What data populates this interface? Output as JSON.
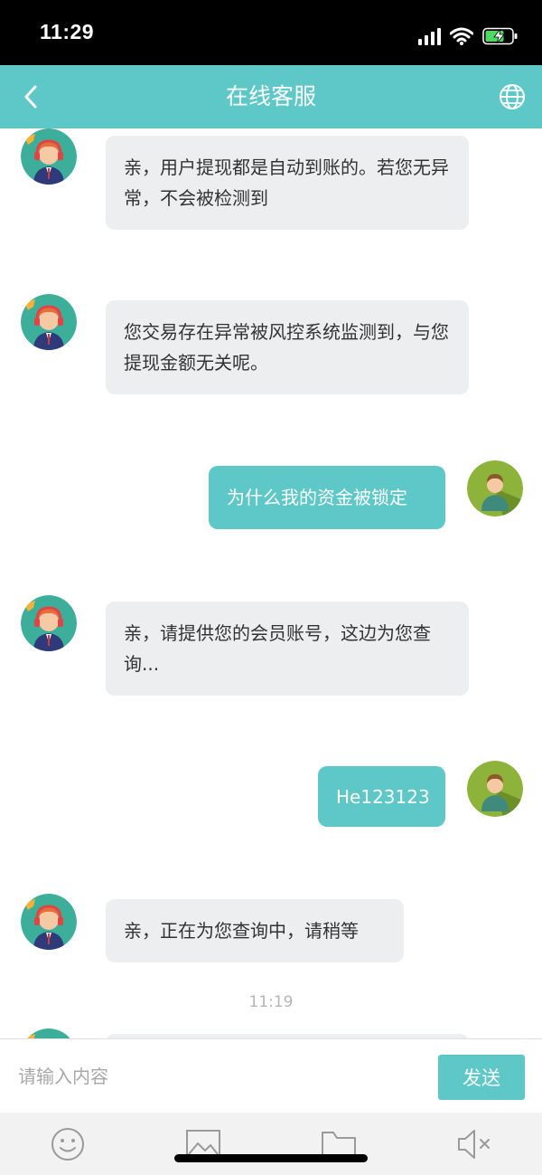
{
  "status_bar": {
    "time": "11:29"
  },
  "nav": {
    "title": "在线客服",
    "back_icon": "chevron-left-icon",
    "globe_icon": "globe-icon"
  },
  "messages": [
    {
      "side": "in",
      "text": "亲，用户提现都是自动到账的。若您无异常，不会被检测到"
    },
    {
      "side": "in",
      "text": "您交易存在异常被风控系统监测到，与您提现金额无关呢。"
    },
    {
      "side": "out",
      "text": "为什么我的资金被锁定"
    },
    {
      "side": "in",
      "text": "亲，请提供您的会员账号，这边为您查询..."
    },
    {
      "side": "out",
      "text": "He123123"
    },
    {
      "side": "in",
      "text": "亲，正在为您查询中，请稍等"
    }
  ],
  "timestamp": "11:19",
  "input": {
    "placeholder": "请输入内容",
    "value": "",
    "send_label": "发送"
  },
  "toolbar": {
    "items": [
      "emoji-icon",
      "image-icon",
      "folder-icon",
      "speaker-mute-icon"
    ]
  },
  "colors": {
    "accent": "#5ec8c8",
    "bubble_in": "#eceef0",
    "status_bar": "#000000",
    "toolbar": "#f2f2f2"
  }
}
